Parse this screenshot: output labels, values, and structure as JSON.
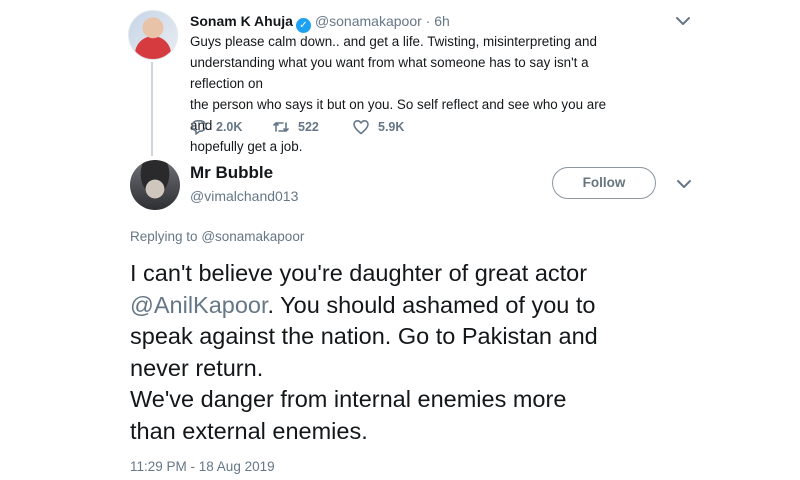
{
  "parent_tweet": {
    "name": "Sonam K Ahuja",
    "handle": "@sonamakapoor",
    "separator": "·",
    "time": "6h",
    "lines": [
      "Guys please calm down.. and get a life. Twisting, misinterpreting and",
      "understanding what you want from what someone has to say isn't a reflection on",
      "the person who says it but on you. So self reflect and see who you are and",
      "hopefully get a job."
    ],
    "replies": "2.0K",
    "retweets": "522",
    "likes": "5.9K",
    "icons": {
      "verified": "verified-badge-icon",
      "menu": "chevron-down-icon",
      "reply": "reply-icon",
      "retweet": "retweet-icon",
      "like": "heart-icon"
    }
  },
  "main_tweet": {
    "name": "Mr Bubble",
    "handle": "@vimalchand013",
    "follow_label": "Follow",
    "replying_prefix": "Replying to",
    "replying_to": "@sonamakapoor",
    "text_parts": {
      "l1": "I can't believe you're daughter of great actor",
      "mention": "@AnilKapoor",
      "l2_rest": ". You should ashamed of you to",
      "l3": "speak against the nation. Go to Pakistan and",
      "l4": "never return.",
      "l5": "We've danger from internal enemies more",
      "l6": "than external enemies."
    },
    "timestamp": "11:29 PM - 18 Aug 2019"
  },
  "colors": {
    "text": "#14171a",
    "secondary": "#657786",
    "verified": "#1da1f2",
    "border": "#8a96a0"
  }
}
